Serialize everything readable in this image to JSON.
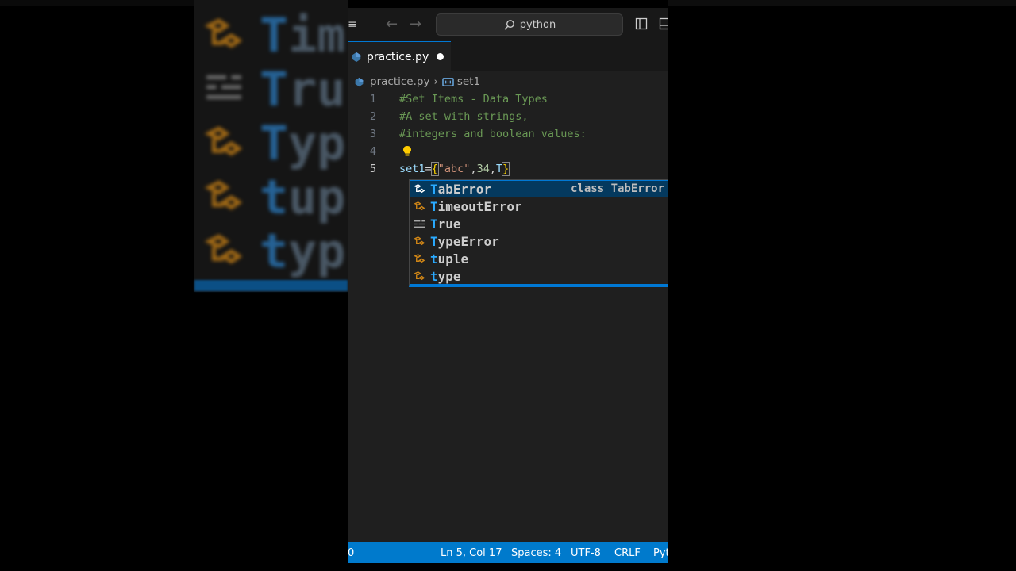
{
  "backdrop": {
    "rows": [
      {
        "first": "T",
        "rest": "im"
      },
      {
        "first": "T",
        "rest": "ru"
      },
      {
        "first": "T",
        "rest": "yp"
      },
      {
        "first": "t",
        "rest": "up"
      },
      {
        "first": "t",
        "rest": "yp"
      }
    ]
  },
  "titlebar": {
    "search_text": "python"
  },
  "tab": {
    "label": "practice.py"
  },
  "breadcrumb": {
    "file": "practice.py",
    "symbol": "set1"
  },
  "code": {
    "lines": [
      {
        "num": "1",
        "text": "#Set Items - Data Types"
      },
      {
        "num": "2",
        "text": "#A set with strings,"
      },
      {
        "num": "3",
        "text": "#integers and boolean values:"
      },
      {
        "num": "4",
        "text": ""
      },
      {
        "num": "5",
        "var": "set1",
        "eq": "=",
        "open": "{",
        "str": "\"abc\"",
        "comma1": ",",
        "num_val": "34",
        "comma2": ",",
        "typed": "T",
        "close": "}"
      }
    ]
  },
  "suggestions": [
    {
      "match": "T",
      "rest": "abError",
      "detail": "class TabError",
      "kind": "class-icon"
    },
    {
      "match": "T",
      "rest": "imeoutError",
      "detail": "",
      "kind": "class-icon"
    },
    {
      "match": "T",
      "rest": "rue",
      "detail": "",
      "kind": "keyword-icon"
    },
    {
      "match": "T",
      "rest": "ypeError",
      "detail": "",
      "kind": "class-icon"
    },
    {
      "match": "t",
      "rest": "uple",
      "detail": "",
      "kind": "class-icon"
    },
    {
      "match": "t",
      "rest": "ype",
      "detail": "",
      "kind": "class-icon"
    }
  ],
  "statusbar": {
    "left": "0",
    "position": "Ln 5, Col 17",
    "spaces": "Spaces: 4",
    "encoding": "UTF-8",
    "eol": "CRLF",
    "language": "Pyt"
  },
  "colors": {
    "accent": "#0078d4",
    "statusbar": "#007acc",
    "comment": "#6a9955",
    "match": "#2aaaff"
  }
}
